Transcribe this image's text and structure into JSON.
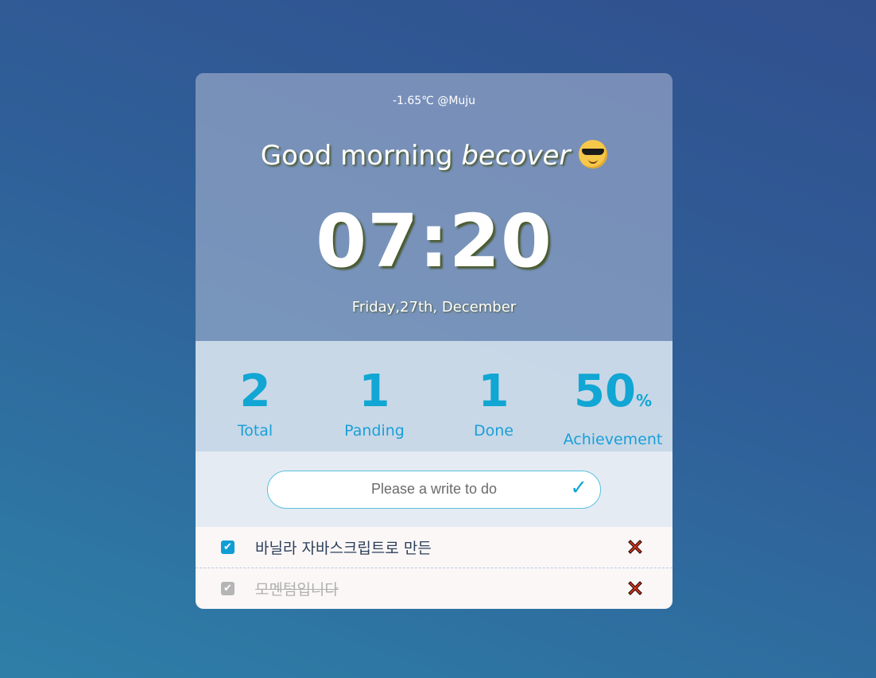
{
  "weather": {
    "text": "-1.65℃ @Muju"
  },
  "greeting": {
    "prefix": "Good morning ",
    "name": "becover"
  },
  "clock": {
    "time": "07:20"
  },
  "date": {
    "text": "Friday,27th, December"
  },
  "stats": {
    "total": {
      "value": "2",
      "label": "Total"
    },
    "pending": {
      "value": "1",
      "label": "Panding"
    },
    "done": {
      "value": "1",
      "label": "Done"
    },
    "achievement": {
      "value": "50",
      "unit": "%",
      "label": "Achievement"
    }
  },
  "input": {
    "placeholder": "Please a write to do",
    "submit_icon": "✓"
  },
  "todos": [
    {
      "text": "바닐라 자바스크립트로 만든",
      "checked": true
    },
    {
      "text": "모멘텀입니다",
      "checked": true
    }
  ],
  "colors": {
    "accent": "#11a6d3",
    "delete": "#e53b1e"
  }
}
